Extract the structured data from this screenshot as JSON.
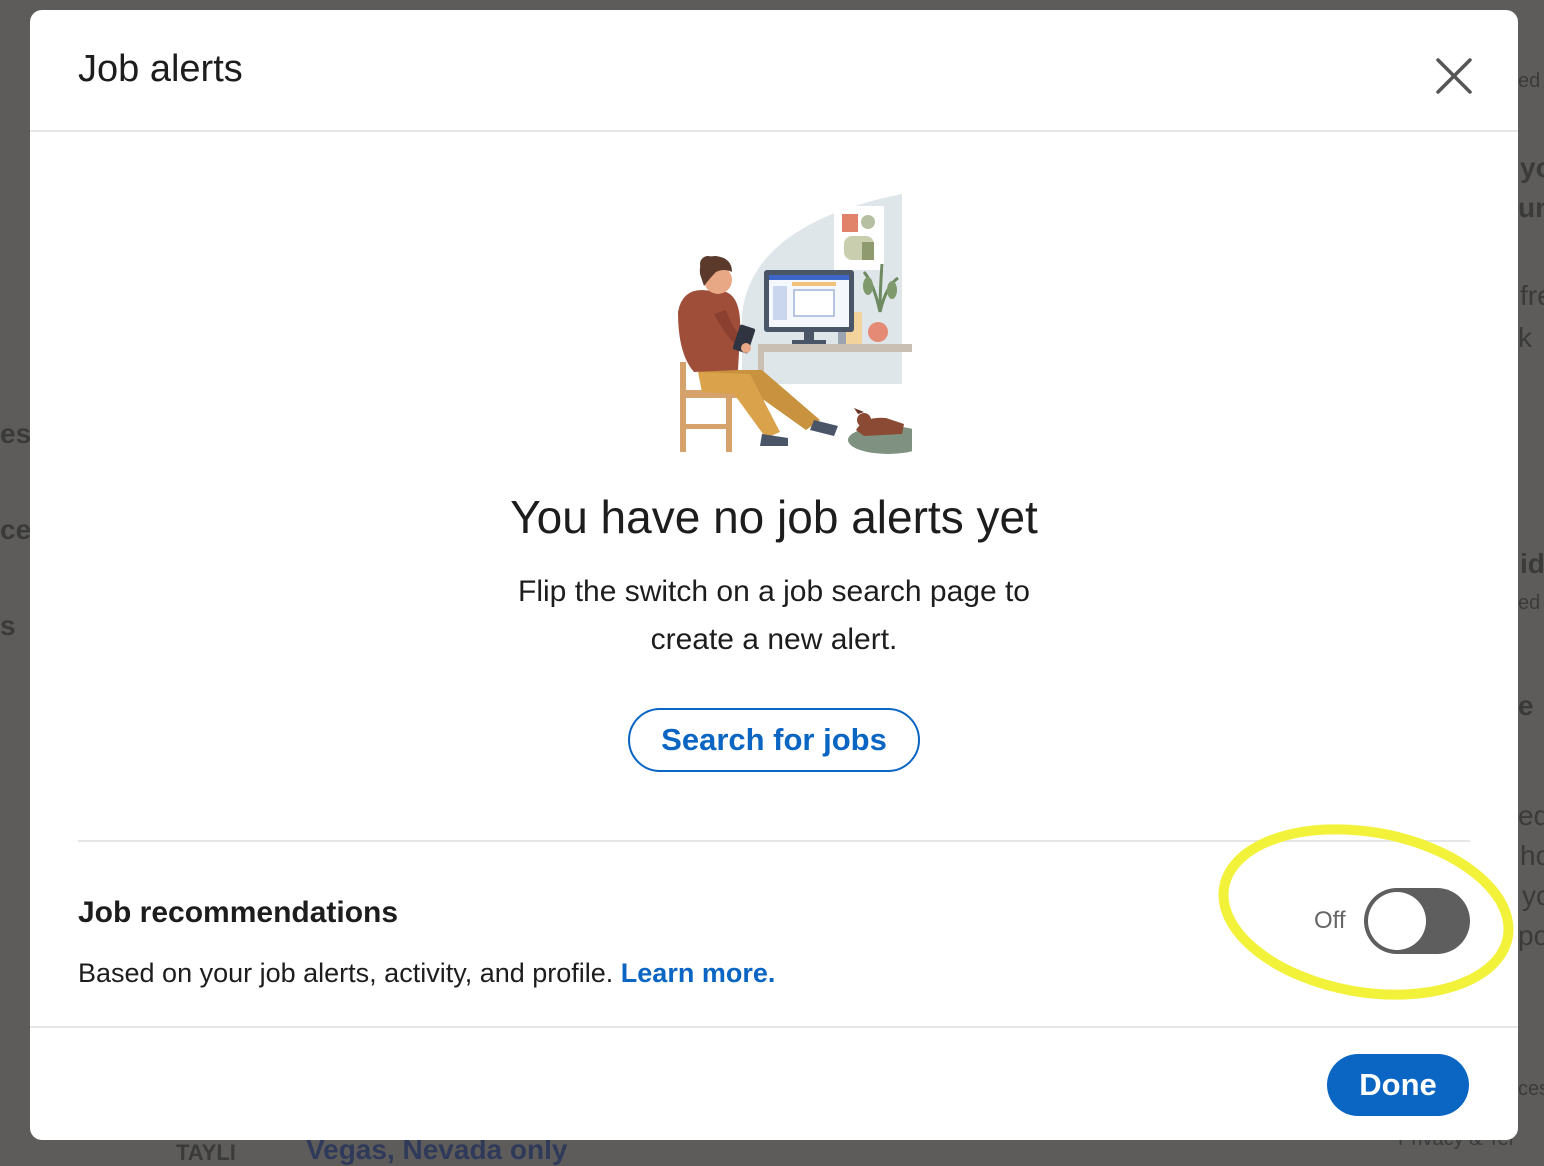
{
  "background_fragments": {
    "left_1": "esig",
    "left_2": "ce",
    "left_3": "s",
    "right_1": "ed",
    "right_2": "yo",
    "right_3": "uni",
    "right_4": "fre",
    "right_5": "k →",
    "right_6": "id",
    "right_7": "ed",
    "right_8": "e",
    "right_9": "ed",
    "right_10": "ho",
    "right_11": "yo",
    "right_12": "po",
    "right_13": "ces",
    "right_14": "Privacy & Ter",
    "bottom_1": "Vegas, Nevada only",
    "bottom_2": "TAYLI"
  },
  "modal": {
    "title": "Job alerts",
    "close_icon": "close-icon",
    "illustration": "person-at-desk-illustration",
    "empty_state": {
      "title": "You have no job alerts yet",
      "description": "Flip the switch on a job search page to create a new alert.",
      "search_button": "Search for jobs"
    },
    "recommendations": {
      "title": "Job recommendations",
      "description": "Based on your job alerts, activity, and profile.",
      "learn_more": "Learn more.",
      "toggle_label": "Off",
      "toggle_on": false
    },
    "footer": {
      "done_button": "Done"
    }
  },
  "colors": {
    "accent": "#0a66c2",
    "toggle_off": "#5e5e5e",
    "overlay": "#5d5c5a",
    "highlight": "#f2f23a"
  }
}
